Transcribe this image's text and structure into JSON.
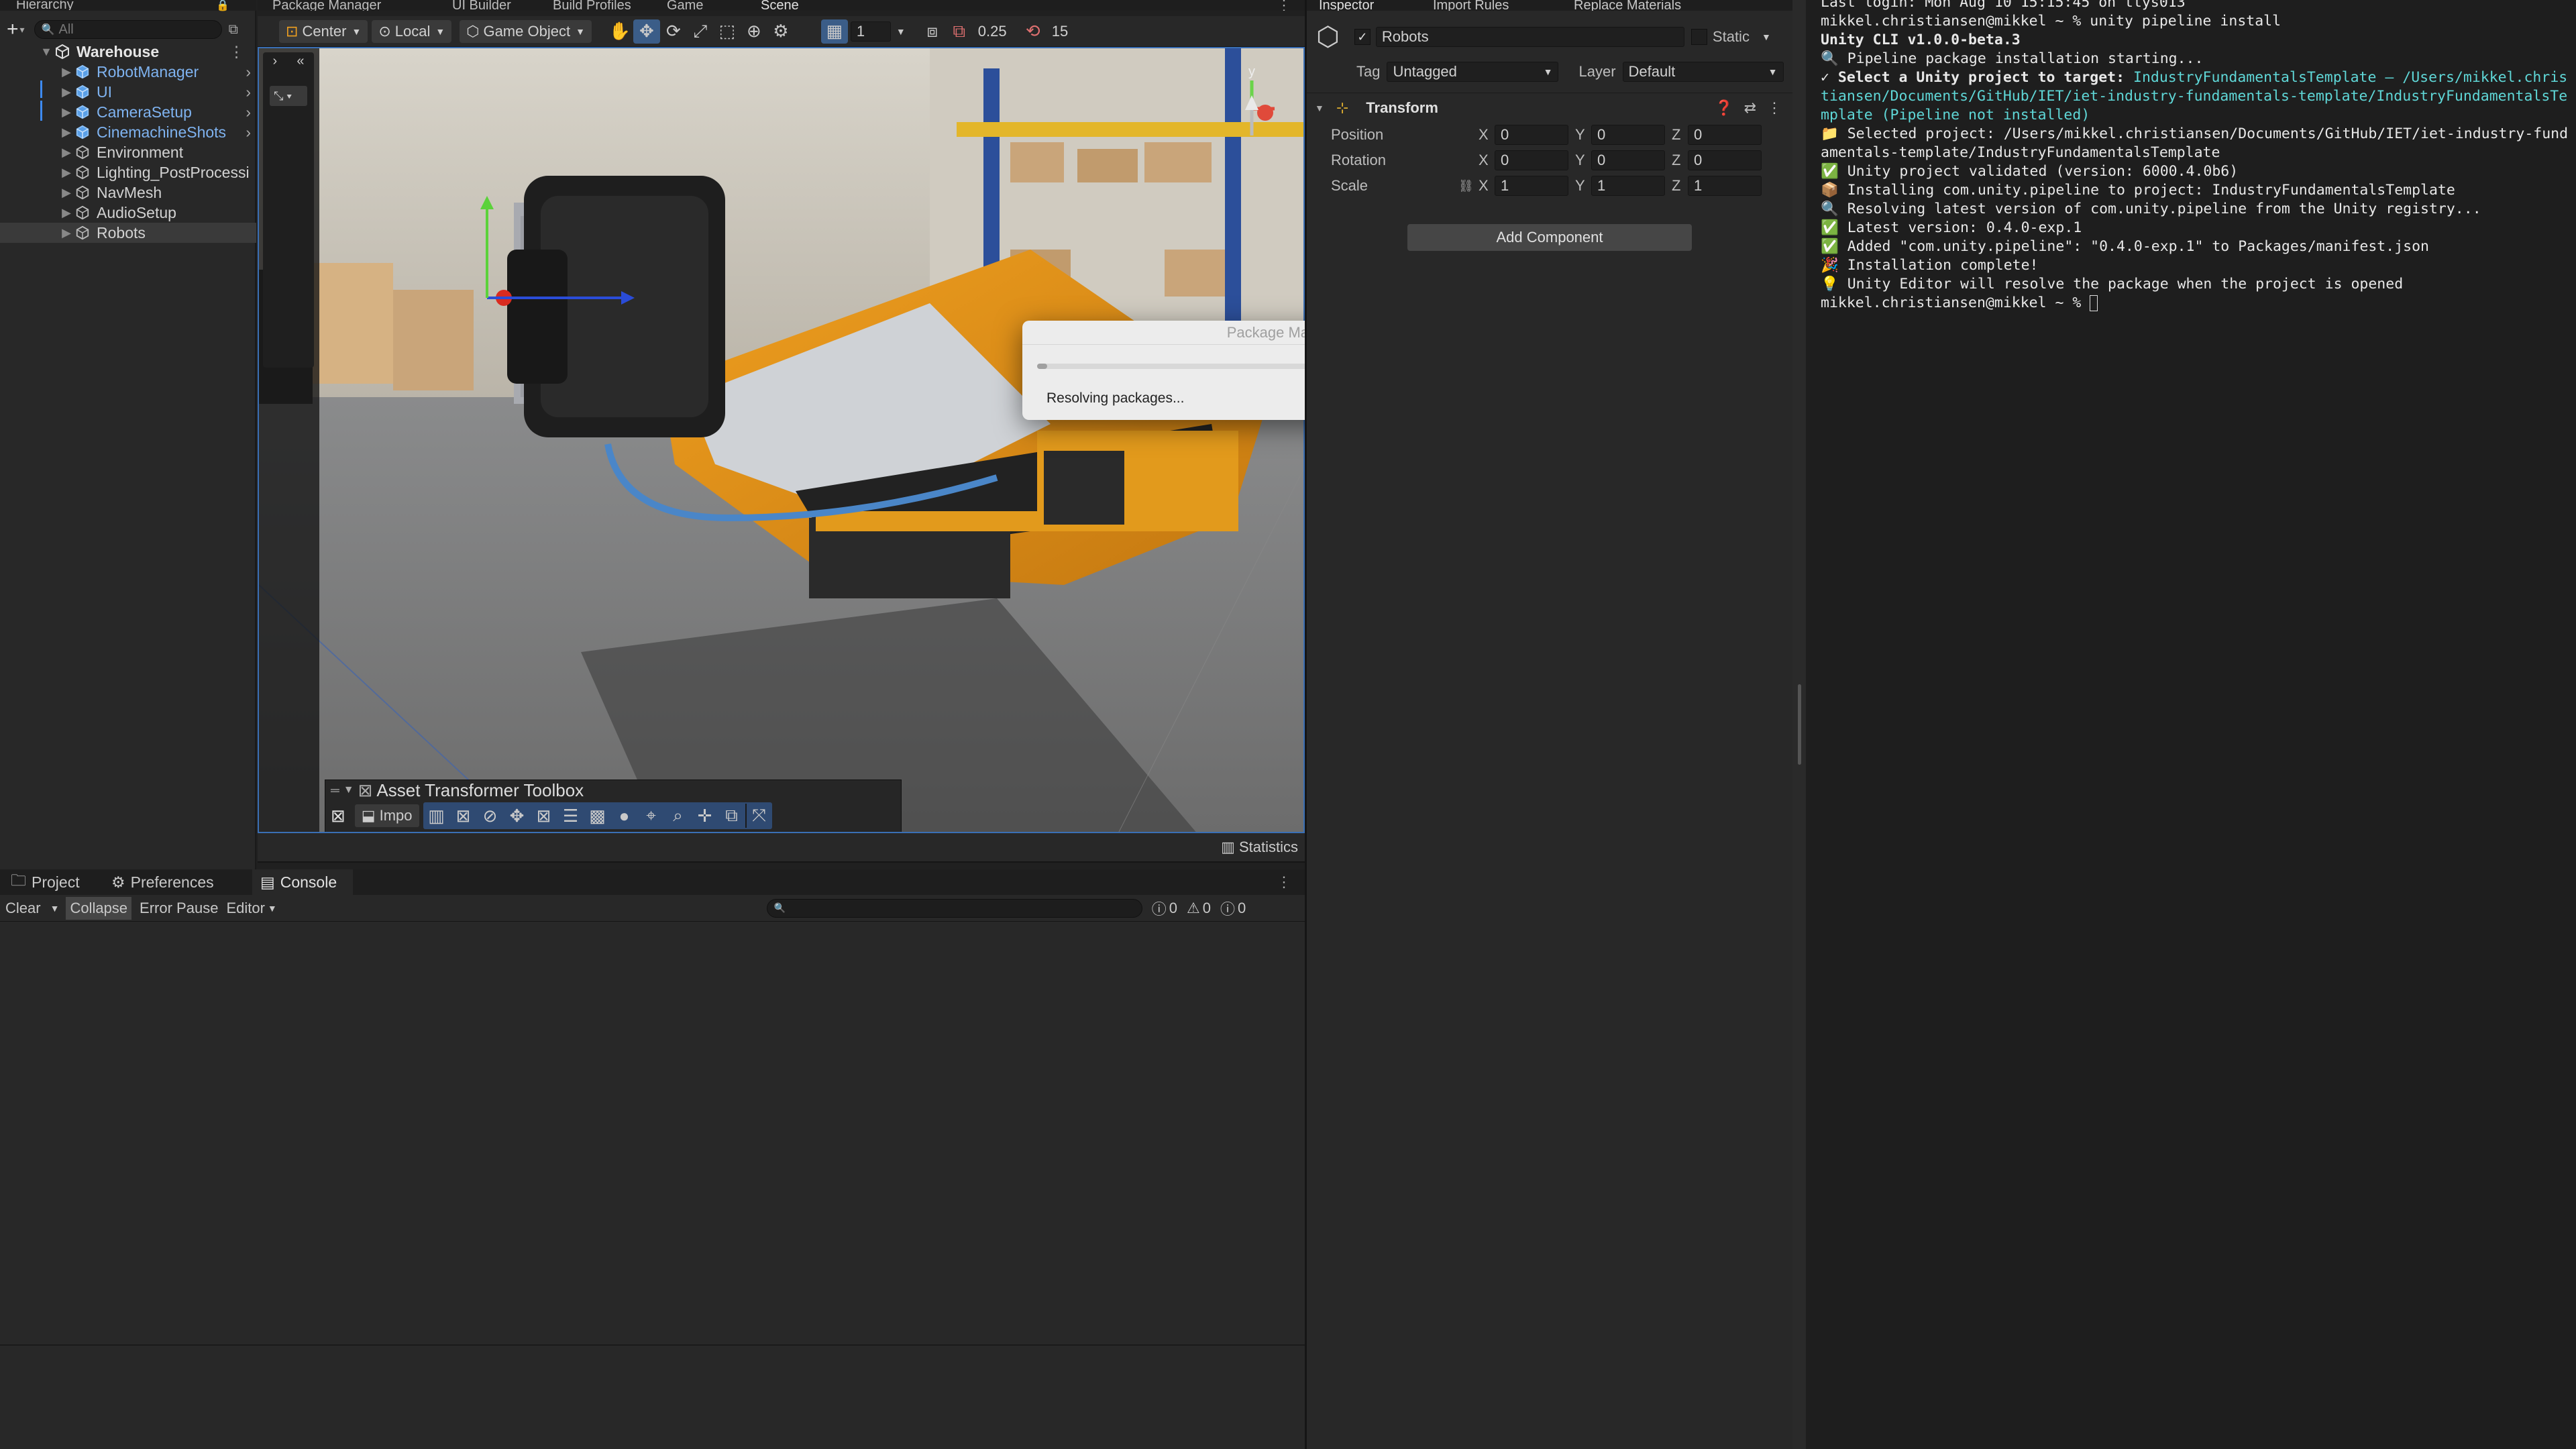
{
  "hierarchy": {
    "tab": "Hierarchy",
    "search_placeholder": "All",
    "scene": "Warehouse",
    "items": [
      {
        "label": "RobotManager",
        "prefab": true,
        "expandable": true
      },
      {
        "label": "UI",
        "prefab": true,
        "expandable": true
      },
      {
        "label": "CameraSetup",
        "prefab": true,
        "expandable": true
      },
      {
        "label": "CinemachineShots",
        "prefab": true,
        "expandable": true
      },
      {
        "label": "Environment",
        "prefab": false
      },
      {
        "label": "Lighting_PostProcessi",
        "prefab": false
      },
      {
        "label": "NavMesh",
        "prefab": false
      },
      {
        "label": "AudioSetup",
        "prefab": false
      },
      {
        "label": "Robots",
        "prefab": false,
        "selected": true
      }
    ]
  },
  "center_tabs": [
    "Package Manager",
    "UI Builder",
    "Build Profiles",
    "Game",
    "Scene"
  ],
  "scene_toolbar": {
    "pivot": "Center",
    "space": "Local",
    "mode": "Game Object",
    "grid_value": "1",
    "snap_value": "0.25",
    "angle_value": "15"
  },
  "scene_view": {
    "gizmo_axis": "y",
    "overlay_title": "Asset Transformer Toolbox",
    "overlay_button": "Impo",
    "statistics": "Statistics"
  },
  "dialog": {
    "title": "Package Manager",
    "status": "Resolving packages...",
    "progress": 0.02
  },
  "bottom_tabs": {
    "project": "Project",
    "preferences": "Preferences",
    "console": "Console"
  },
  "console_toolbar": {
    "clear": "Clear",
    "collapse": "Collapse",
    "error_pause": "Error Pause",
    "editor": "Editor",
    "errors": "0",
    "warnings": "0",
    "logs": "0"
  },
  "inspector": {
    "tabs": [
      "Inspector",
      "Import Rules",
      "Replace Materials"
    ],
    "object_name": "Robots",
    "static_label": "Static",
    "tag_label": "Tag",
    "tag_value": "Untagged",
    "layer_label": "Layer",
    "layer_value": "Default",
    "component": "Transform",
    "position": {
      "label": "Position",
      "x": "0",
      "y": "0",
      "z": "0"
    },
    "rotation": {
      "label": "Rotation",
      "x": "0",
      "y": "0",
      "z": "0"
    },
    "scale": {
      "label": "Scale",
      "x": "1",
      "y": "1",
      "z": "1"
    },
    "add_component": "Add Component"
  },
  "terminal": {
    "lines": [
      "Last login: Mon Aug 10 15:15:45 on ttys013",
      "mikkel.christiansen@mikkel ~ % unity pipeline install",
      "Unity CLI v1.0.0-beta.3",
      "🔍 Pipeline package installation starting...",
      "✓ Select a Unity project to target: ",
      "IndustryFundamentalsTemplate — /Users/mikkel.christiansen/Documents/GitHub/IET/iet-industry-fundamentals-template/IndustryFundamentalsTemplate (Pipeline not installed)",
      "📁 Selected project: /Users/mikkel.christiansen/Documents/GitHub/IET/iet-industry-fundamentals-template/IndustryFundamentalsTemplate",
      "✅ Unity project validated (version: 6000.4.0b6)",
      "📦 Installing com.unity.pipeline to project: IndustryFundamentalsTemplate",
      "🔍 Resolving latest version of com.unity.pipeline from the Unity registry...",
      "✅ Latest version: 0.4.0-exp.1",
      "✅ Added \"com.unity.pipeline\": \"0.4.0-exp.1\" to Packages/manifest.json",
      "🎉 Installation complete!",
      "💡 Unity Editor will resolve the package when the project is opened",
      "mikkel.christiansen@mikkel ~ % "
    ]
  }
}
